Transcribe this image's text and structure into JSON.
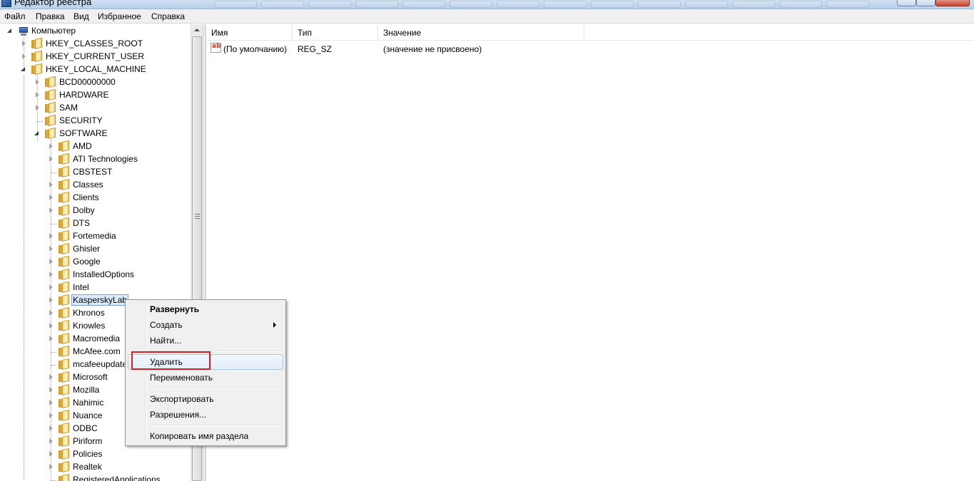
{
  "window": {
    "title": "Редактор реестра"
  },
  "menubar": [
    "Файл",
    "Правка",
    "Вид",
    "Избранное",
    "Справка"
  ],
  "tree": {
    "root": "Компьютер",
    "hives": [
      {
        "label": "HKEY_CLASSES_ROOT",
        "state": "collapsed"
      },
      {
        "label": "HKEY_CURRENT_USER",
        "state": "collapsed"
      },
      {
        "label": "HKEY_LOCAL_MACHINE",
        "state": "expanded"
      }
    ],
    "hklm_children": [
      {
        "label": "BCD00000000",
        "state": "collapsed"
      },
      {
        "label": "HARDWARE",
        "state": "collapsed"
      },
      {
        "label": "SAM",
        "state": "collapsed"
      },
      {
        "label": "SECURITY",
        "state": "none"
      },
      {
        "label": "SOFTWARE",
        "state": "expanded"
      }
    ],
    "software_children": [
      {
        "label": "AMD",
        "state": "collapsed"
      },
      {
        "label": "ATI Technologies",
        "state": "collapsed"
      },
      {
        "label": "CBSTEST",
        "state": "none"
      },
      {
        "label": "Classes",
        "state": "collapsed"
      },
      {
        "label": "Clients",
        "state": "collapsed"
      },
      {
        "label": "Dolby",
        "state": "collapsed"
      },
      {
        "label": "DTS",
        "state": "none"
      },
      {
        "label": "Fortemedia",
        "state": "collapsed"
      },
      {
        "label": "Ghisler",
        "state": "collapsed"
      },
      {
        "label": "Google",
        "state": "collapsed"
      },
      {
        "label": "InstalledOptions",
        "state": "collapsed"
      },
      {
        "label": "Intel",
        "state": "collapsed"
      },
      {
        "label": "KasperskyLab",
        "state": "collapsed",
        "selected": true
      },
      {
        "label": "Khronos",
        "state": "collapsed"
      },
      {
        "label": "Knowles",
        "state": "collapsed"
      },
      {
        "label": "Macromedia",
        "state": "collapsed"
      },
      {
        "label": "McAfee.com",
        "state": "none"
      },
      {
        "label": "mcafeeupdate",
        "state": "none"
      },
      {
        "label": "Microsoft",
        "state": "collapsed"
      },
      {
        "label": "Mozilla",
        "state": "collapsed"
      },
      {
        "label": "Nahimic",
        "state": "collapsed"
      },
      {
        "label": "Nuance",
        "state": "collapsed"
      },
      {
        "label": "ODBC",
        "state": "collapsed"
      },
      {
        "label": "Piriform",
        "state": "collapsed"
      },
      {
        "label": "Policies",
        "state": "collapsed"
      },
      {
        "label": "Realtek",
        "state": "collapsed"
      },
      {
        "label": "RegisteredApplications",
        "state": "none"
      }
    ]
  },
  "values_pane": {
    "columns": [
      "Имя",
      "Тип",
      "Значение"
    ],
    "rows": [
      {
        "name": "(По умолчанию)",
        "type": "REG_SZ",
        "data": "(значение не присвоено)",
        "icon": "string-value-icon"
      }
    ]
  },
  "context_menu": {
    "items": [
      {
        "label": "Развернуть",
        "bold": true
      },
      {
        "label": "Создать",
        "submenu": true
      },
      {
        "label": "Найти..."
      },
      {
        "separator": true
      },
      {
        "label": "Удалить",
        "hover": true,
        "highlighted": true
      },
      {
        "label": "Переименовать"
      },
      {
        "separator": true
      },
      {
        "label": "Экспортировать"
      },
      {
        "label": "Разрешения..."
      },
      {
        "separator": true
      },
      {
        "label": "Копировать имя раздела"
      }
    ]
  },
  "colors": {
    "highlight_box": "#d42020",
    "selection": "#dcebfc",
    "menu_hover": "#e3edfa"
  }
}
